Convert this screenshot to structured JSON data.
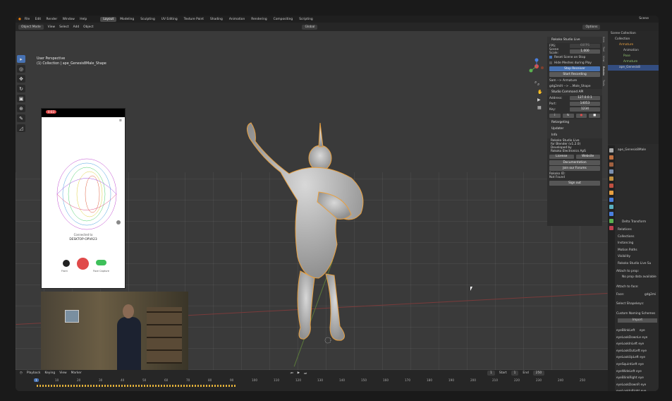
{
  "menubar": {
    "items": [
      "File",
      "Edit",
      "Render",
      "Window",
      "Help"
    ],
    "scene_label": "Scene"
  },
  "workspace_tabs": [
    {
      "label": "Layout",
      "active": true
    },
    {
      "label": "Modeling"
    },
    {
      "label": "Sculpting"
    },
    {
      "label": "UV Editing"
    },
    {
      "label": "Texture Paint"
    },
    {
      "label": "Shading"
    },
    {
      "label": "Animation"
    },
    {
      "label": "Rendering"
    },
    {
      "label": "Compositing"
    },
    {
      "label": "Scripting"
    }
  ],
  "header": {
    "mode": "Object Mode",
    "menus": [
      "View",
      "Select",
      "Add",
      "Object"
    ],
    "transform_orientation": "Global",
    "options": "Options"
  },
  "viewport": {
    "perspective": "User Perspective",
    "collection_info": "(1) Collection | ape_Genesis8Male_Shape"
  },
  "phone_app": {
    "status_badge": "0:03",
    "connected_label": "Connected to",
    "device_name": "DESKTOP-OPVA23",
    "left_button_label": "Front",
    "right_button_label": "Face Capture"
  },
  "npanel": {
    "rokoko_header": "Rokoko Studio Live",
    "fps_label": "FPS:",
    "fps_value": "60FPS",
    "scene_scale_label": "Scene Scale:",
    "scene_scale_value": "1.000",
    "reset_scene": "Reset Scene on Stop",
    "hide_meshes": "Hide Meshes during Play",
    "stop_receiver": "Stop Receiver",
    "start_recording": "Start Recording",
    "sam_item": "Sam  --> Armature",
    "face_item": "gdg2milt  --> ...Male_Shape",
    "command_api_header": "Studio Command API",
    "address_label": "Address:",
    "address_value": "127.0.0.1",
    "port_label": "Port:",
    "port_value": "14053",
    "key_label": "Key:",
    "key_value": "1234",
    "retargeting": "Retargeting",
    "updater": "Updater",
    "info": "Info",
    "info_line1": "Rokoko Studio Live",
    "info_line2": "for Blender (v1.2.0)",
    "info_line3": "Developed by",
    "info_line4": "Rokoko Electronics ApS",
    "license": "License",
    "website": "Website",
    "documentation": "Documentation",
    "join_forums": "Join our Forums",
    "rokoko_id": "Rokoko ID:",
    "not_found": "Not Found",
    "sign_out": "Sign out"
  },
  "side_tabs": [
    "Item",
    "Tool",
    "View",
    "Rokoko",
    "Tools"
  ],
  "outliner": {
    "rows": [
      {
        "label": "Scene Collection",
        "indent": 0
      },
      {
        "label": "Collection",
        "indent": 1
      },
      {
        "label": "Armature",
        "indent": 2
      },
      {
        "label": "Animation",
        "indent": 3
      },
      {
        "label": "Pose",
        "indent": 3
      },
      {
        "label": "Armature",
        "indent": 3
      },
      {
        "label": "ape_Genesis8",
        "indent": 2,
        "selected": true
      }
    ]
  },
  "properties": {
    "object_name": "ape_Genesis8Male",
    "delta_transform": "Delta Transform",
    "sections": [
      "Relations",
      "Collections",
      "Instancing",
      "Motion Paths",
      "Visibility",
      "Rokoko Studio Live Su"
    ],
    "attach_to_prop": "Attach to prop:",
    "no_prop_data": "No prop data available",
    "attach_to_face": "Attach to face:",
    "face_label": "Face:",
    "face_value": "gdg2mi",
    "select_shapekeys": "Select Shapekeys:",
    "custom_naming": "Custom Naming Schemes",
    "import_label": "Import",
    "shapekeys": [
      "eyeBlinkLeft",
      "eyeLookDownLe",
      "eyeLookInLeft",
      "eyeLookOutLeft",
      "eyeLookUpLeft",
      "eyeSquintLeft",
      "eyeWideLeft",
      "eyeBlinkRight",
      "eyeLookDownR",
      "eyeLookInRight",
      "eyeLookOutRight"
    ],
    "shapekey_value": "eye"
  },
  "timeline": {
    "menus": [
      "Playback",
      "Keying",
      "View",
      "Marker"
    ],
    "current_frame": "1",
    "start_label": "Start",
    "start_value": "1",
    "end_label": "End",
    "end_value": "250",
    "ruler": [
      "1",
      "10",
      "20",
      "30",
      "40",
      "50",
      "60",
      "70",
      "80",
      "90",
      "100",
      "110",
      "120",
      "130",
      "140",
      "150",
      "160",
      "170",
      "180",
      "190",
      "200",
      "210",
      "220",
      "230",
      "240",
      "250"
    ]
  },
  "colors": {
    "accent": "#4772b3",
    "record": "#e04a4a",
    "selection_outline": "#e8a040",
    "keyframe": "#e2b03a"
  },
  "icons": [
    "select-box-icon",
    "cursor-icon",
    "move-icon",
    "rotate-icon",
    "scale-icon",
    "transform-icon",
    "annotate-icon",
    "measure-icon"
  ]
}
